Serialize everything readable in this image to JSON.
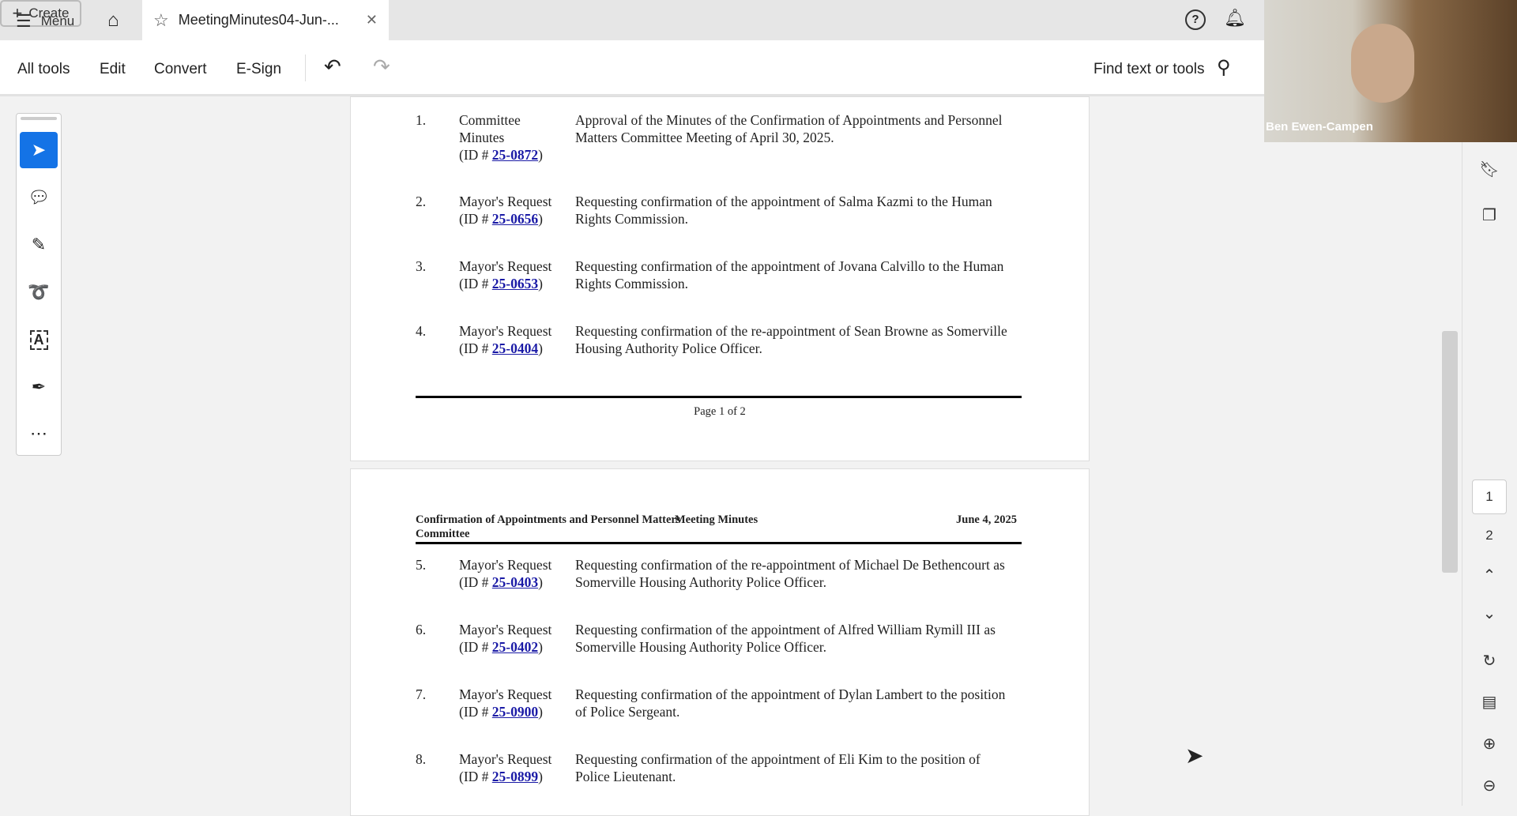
{
  "topbar": {
    "menu": "Menu",
    "tab_title": "MeetingMinutes04-Jun-...",
    "create": "Create"
  },
  "toolbar": {
    "all_tools": "All tools",
    "edit": "Edit",
    "convert": "Convert",
    "esign": "E-Sign",
    "find": "Find text or tools"
  },
  "webcam": {
    "name": "Ben Ewen-Campen"
  },
  "page1": {
    "items": [
      {
        "num": "1.",
        "type": "Committee Minutes",
        "id_prefix": "(ID # ",
        "id": "25-0872",
        "id_suffix": ")",
        "desc": "Approval of the Minutes of the Confirmation of Appointments and Personnel Matters Committee Meeting of April 30, 2025."
      },
      {
        "num": "2.",
        "type": "Mayor's Request",
        "id_prefix": "(ID # ",
        "id": "25-0656",
        "id_suffix": ")",
        "desc": "Requesting confirmation of the appointment of Salma Kazmi to the Human Rights Commission."
      },
      {
        "num": "3.",
        "type": "Mayor's Request",
        "id_prefix": "(ID # ",
        "id": "25-0653",
        "id_suffix": ")",
        "desc": "Requesting confirmation of the appointment of Jovana Calvillo to the Human Rights Commission."
      },
      {
        "num": "4.",
        "type": "Mayor's Request",
        "id_prefix": "(ID # ",
        "id": "25-0404",
        "id_suffix": ")",
        "desc": "Requesting confirmation of the re-appointment of Sean Browne as Somerville Housing Authority Police Officer."
      }
    ],
    "footer": "Page 1 of 2"
  },
  "page2": {
    "header_left": "Confirmation of Appointments and Personnel Matters Committee",
    "header_center": "Meeting Minutes",
    "header_right": "June 4, 2025",
    "items": [
      {
        "num": "5.",
        "type": "Mayor's Request",
        "id_prefix": "(ID # ",
        "id": "25-0403",
        "id_suffix": ")",
        "desc": "Requesting confirmation of the re-appointment of Michael De Bethencourt as Somerville Housing Authority Police Officer."
      },
      {
        "num": "6.",
        "type": "Mayor's Request",
        "id_prefix": "(ID # ",
        "id": "25-0402",
        "id_suffix": ")",
        "desc": "Requesting confirmation of the appointment of Alfred William Rymill III as Somerville Housing Authority Police Officer."
      },
      {
        "num": "7.",
        "type": "Mayor's Request",
        "id_prefix": "(ID # ",
        "id": "25-0900",
        "id_suffix": ")",
        "desc": "Requesting confirmation of the appointment of Dylan Lambert to the position of Police Sergeant."
      },
      {
        "num": "8.",
        "type": "Mayor's Request",
        "id_prefix": "(ID # ",
        "id": "25-0899",
        "id_suffix": ")",
        "desc": "Requesting confirmation of the appointment of Eli Kim to the position of Police Lieutenant."
      }
    ]
  },
  "rail": {
    "page_1": "1",
    "page_2": "2"
  },
  "colors": {
    "accent": "#1473e6",
    "link": "#1a1aa6"
  }
}
